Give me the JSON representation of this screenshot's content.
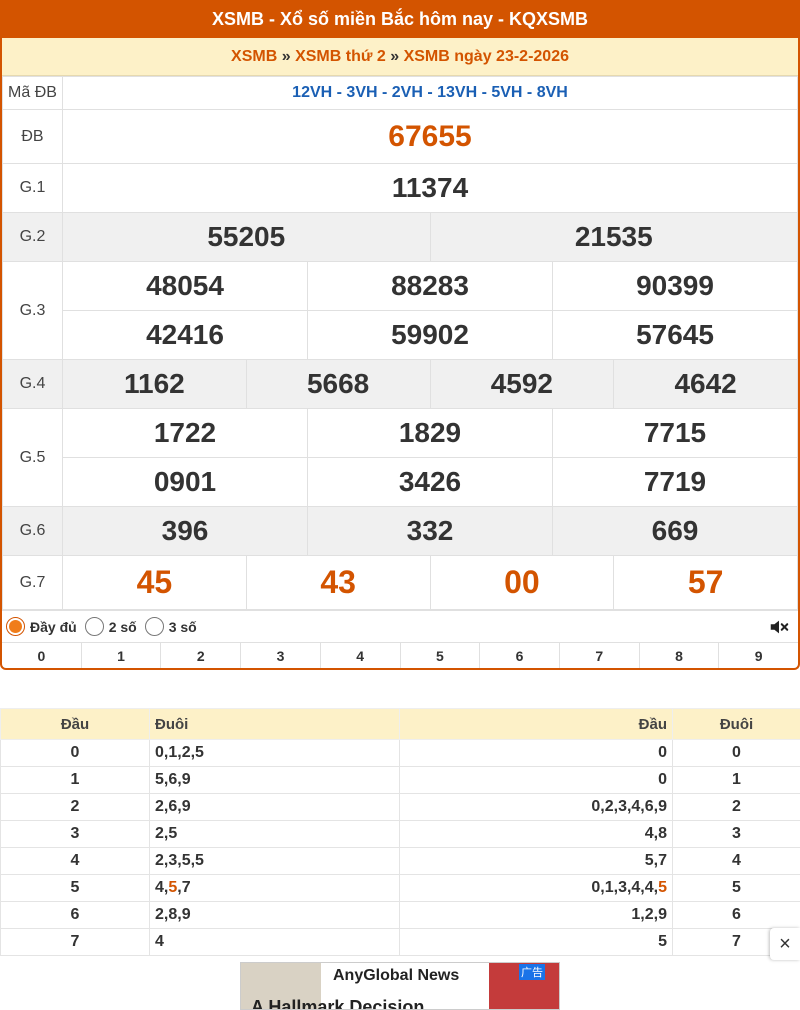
{
  "header": {
    "title": "XSMB - Xổ số miền Bắc hôm nay - KQXSMB"
  },
  "breadcrumb": {
    "items": [
      "XSMB",
      "XSMB thứ 2",
      "XSMB ngày 23-2-2026"
    ],
    "sep": "»"
  },
  "results": {
    "ma_db_label": "Mã ĐB",
    "ma_db": "12VH - 3VH - 2VH - 13VH - 5VH - 8VH",
    "db_label": "ĐB",
    "db": "67655",
    "g1_label": "G.1",
    "g1": "11374",
    "g2_label": "G.2",
    "g2": [
      "55205",
      "21535"
    ],
    "g3_label": "G.3",
    "g3": [
      "48054",
      "88283",
      "90399",
      "42416",
      "59902",
      "57645"
    ],
    "g4_label": "G.4",
    "g4": [
      "1162",
      "5668",
      "4592",
      "4642"
    ],
    "g5_label": "G.5",
    "g5": [
      "1722",
      "1829",
      "7715",
      "0901",
      "3426",
      "7719"
    ],
    "g6_label": "G.6",
    "g6": [
      "396",
      "332",
      "669"
    ],
    "g7_label": "G.7",
    "g7": [
      "45",
      "43",
      "00",
      "57"
    ]
  },
  "display_options": {
    "options": [
      "Đầy đủ",
      "2 số",
      "3 số"
    ],
    "selected": "Đầy đủ"
  },
  "digit_bar": [
    "0",
    "1",
    "2",
    "3",
    "4",
    "5",
    "6",
    "7",
    "8",
    "9"
  ],
  "dau_duoi": {
    "headers": [
      "Đầu",
      "Đuôi",
      "Đầu",
      "Đuôi"
    ],
    "rows": [
      {
        "dau": "0",
        "duoi": "0,1,2,5",
        "dau2": "0",
        "duoi2": "0"
      },
      {
        "dau": "1",
        "duoi": "5,6,9",
        "dau2": "0",
        "duoi2": "1"
      },
      {
        "dau": "2",
        "duoi": "2,6,9",
        "dau2": "0,2,3,4,6,9",
        "duoi2": "2"
      },
      {
        "dau": "3",
        "duoi": "2,5",
        "dau2": "4,8",
        "duoi2": "3"
      },
      {
        "dau": "4",
        "duoi": "2,3,5,5",
        "dau2": "5,7",
        "duoi2": "4"
      },
      {
        "dau": "5",
        "duoi_pre": "4,",
        "duoi_hl": "5",
        "duoi_post": ",7",
        "dau2_pre": "0,1,3,4,4,",
        "dau2_hl": "5",
        "duoi2": "5"
      },
      {
        "dau": "6",
        "duoi": "2,8,9",
        "dau2": "1,2,9",
        "duoi2": "6"
      },
      {
        "dau": "7",
        "duoi": "4",
        "dau2": "5",
        "duoi2": "7"
      }
    ]
  },
  "ad": {
    "title": "AnyGlobal News",
    "tag": "广告",
    "big": "A Hallmark Decision",
    "close": "×"
  },
  "colors": {
    "brand": "#d35400",
    "code": "#1a5fb4",
    "crumb_bg": "#fdf1c8"
  }
}
